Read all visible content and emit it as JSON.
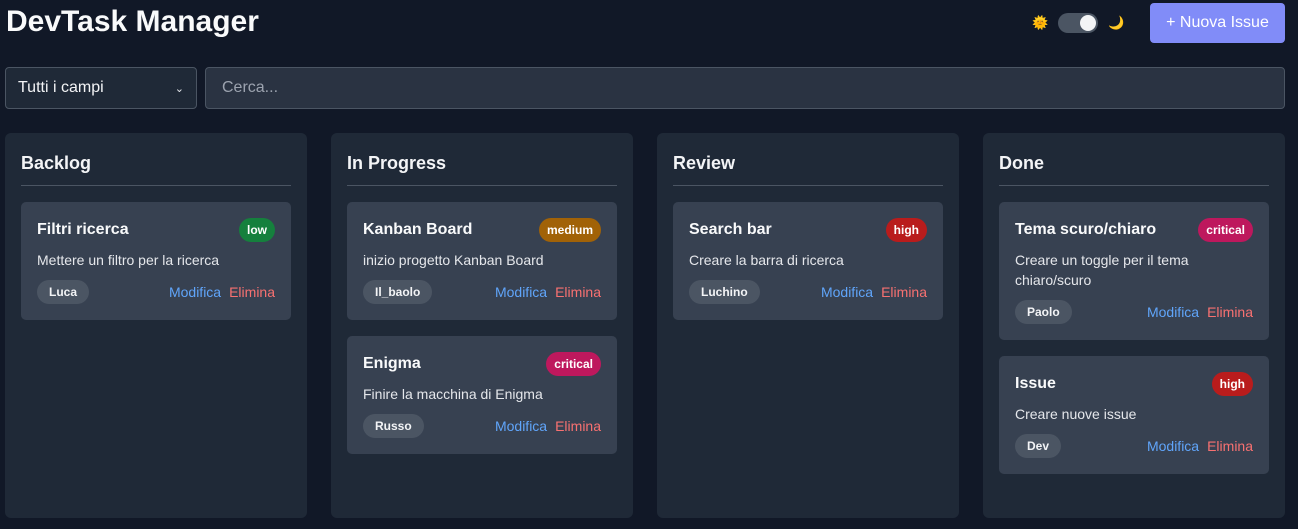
{
  "header": {
    "title": "DevTask Manager",
    "sun_glyph": "🌞",
    "moon_glyph": "🌙",
    "new_issue_label": "+ Nuova Issue",
    "accent_color": "#818cf8"
  },
  "filter": {
    "selected_field": "Tutti i campi",
    "chevron_glyph": "⌄",
    "search_placeholder": "Cerca...",
    "search_value": ""
  },
  "actions": {
    "edit_label": "Modifica",
    "delete_label": "Elimina"
  },
  "priority_colors": {
    "low": "#15803d",
    "medium": "#a16207",
    "high": "#b91c1c",
    "critical": "#be185d"
  },
  "columns": [
    {
      "title": "Backlog",
      "cards": [
        {
          "title": "Filtri ricerca",
          "priority": "low",
          "description": "Mettere un filtro per la ricerca",
          "assignee": "Luca"
        }
      ]
    },
    {
      "title": "In Progress",
      "cards": [
        {
          "title": "Kanban Board",
          "priority": "medium",
          "description": "inizio progetto Kanban Board",
          "assignee": "Il_baolo"
        },
        {
          "title": "Enigma",
          "priority": "critical",
          "description": "Finire la macchina di Enigma",
          "assignee": "Russo"
        }
      ]
    },
    {
      "title": "Review",
      "cards": [
        {
          "title": "Search bar",
          "priority": "high",
          "description": "Creare la barra di ricerca",
          "assignee": "Luchino"
        }
      ]
    },
    {
      "title": "Done",
      "cards": [
        {
          "title": "Tema scuro/chiaro",
          "priority": "critical",
          "description": "Creare un toggle per il tema chiaro/scuro",
          "assignee": "Paolo"
        },
        {
          "title": "Issue",
          "priority": "high",
          "description": "Creare nuove issue",
          "assignee": "Dev"
        }
      ]
    }
  ]
}
